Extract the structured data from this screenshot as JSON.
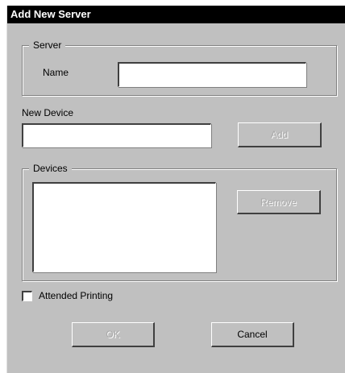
{
  "window": {
    "title": "Add New Server"
  },
  "server_group": {
    "label": "Server",
    "name_label": "Name",
    "name_value": ""
  },
  "new_device": {
    "label": "New Device",
    "value": "",
    "add_label": "Add"
  },
  "devices_group": {
    "label": "Devices",
    "items": [],
    "remove_label": "Remove"
  },
  "attended_printing": {
    "label": "Attended Printing",
    "checked": false
  },
  "footer": {
    "ok_label": "OK",
    "cancel_label": "Cancel"
  },
  "colors": {
    "title_bar": "#000000",
    "dialog_face": "#c0c0c0",
    "field_bg": "#ffffff",
    "disabled_text": "#a8a8a8"
  }
}
